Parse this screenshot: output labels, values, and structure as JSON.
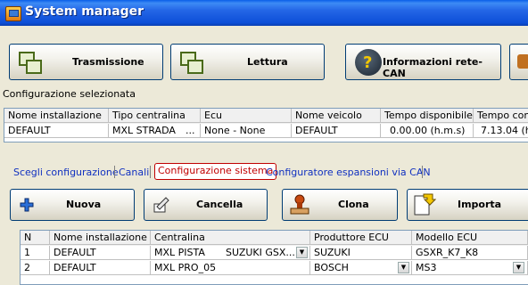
{
  "window": {
    "title": "System manager"
  },
  "toolbar": {
    "trasmissione": "Trasmissione",
    "lettura": "Lettura",
    "informazioni": "Informazioni rete-CAN"
  },
  "config": {
    "label": "Configurazione selezionata",
    "columns": [
      "Nome installazione",
      "Tipo centralina",
      "Ecu",
      "Nome veicolo",
      "Tempo disponibile",
      "Tempo con C"
    ],
    "rows": [
      [
        "DEFAULT",
        "MXL STRADA",
        "None - None",
        "DEFAULT",
        "0.00.00 (h.m.s)",
        "7.13.04 (h.n"
      ]
    ],
    "ellipsis": "..."
  },
  "tabs": [
    {
      "label": "Scegli configurazione"
    },
    {
      "label": "Canali"
    },
    {
      "label": "Configurazione sistema"
    },
    {
      "label": "Configuratore espansioni via CAN"
    }
  ],
  "actions": {
    "nuova": "Nuova",
    "cancella": "Cancella",
    "clona": "Clona",
    "importa": "Importa"
  },
  "installs": {
    "columns": [
      "N",
      "Nome installazione",
      "Centralina",
      "Produttore ECU",
      "Modello ECU"
    ],
    "rows": [
      {
        "n": "1",
        "name": "DEFAULT",
        "centralina": "MXL PISTA",
        "centralina_ecu": "SUZUKI GSX...",
        "produttore": "SUZUKI",
        "modello": "GSXR_K7_K8"
      },
      {
        "n": "2",
        "name": "DEFAULT",
        "centralina": "MXL PRO_05",
        "centralina_ecu": "",
        "produttore": "BOSCH",
        "modello": "MS3"
      }
    ]
  }
}
